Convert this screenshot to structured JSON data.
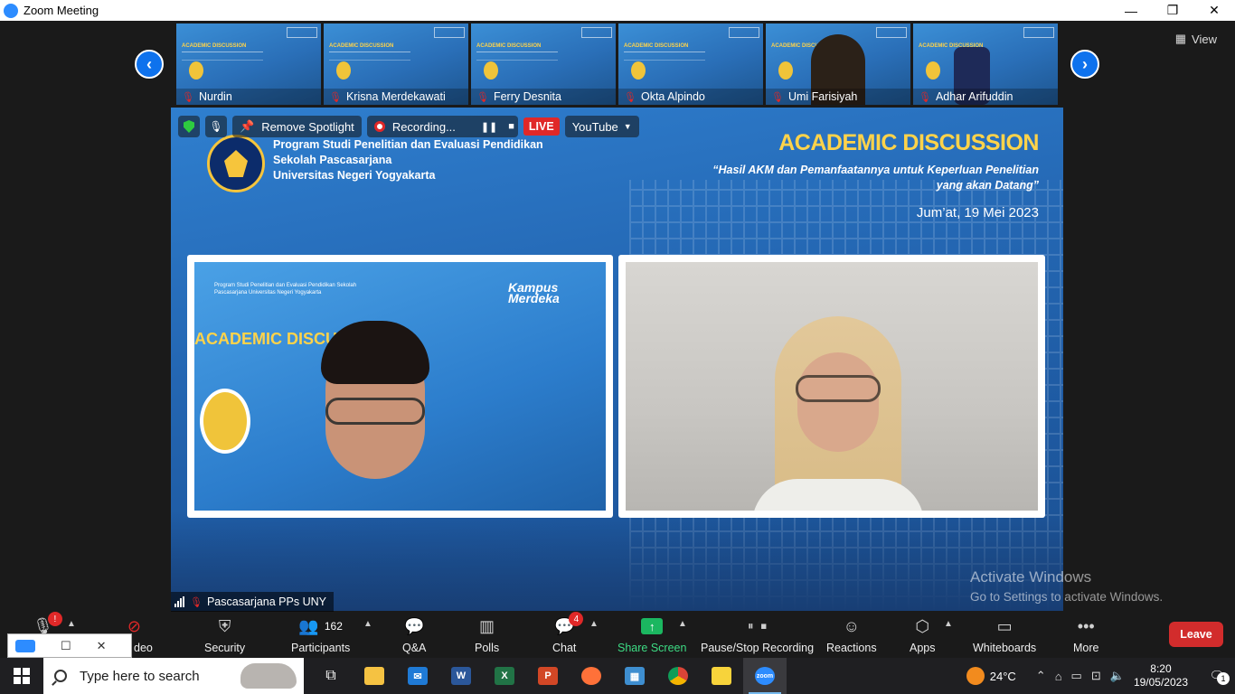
{
  "window": {
    "title": "Zoom Meeting",
    "minimize": "—",
    "restore": "❐",
    "close": "✕"
  },
  "gallery": {
    "prev_arrow": "‹",
    "next_arrow": "›",
    "view_label": "View",
    "participants": [
      {
        "name": "Nurdin",
        "muted": true
      },
      {
        "name": "Krisna Merdekawati",
        "muted": true
      },
      {
        "name": "Ferry Desnita",
        "muted": true
      },
      {
        "name": "Okta Alpindo",
        "muted": true
      },
      {
        "name": "Umi Farisiyah",
        "muted": true
      },
      {
        "name": "Adhar Arifuddin",
        "muted": true
      }
    ],
    "thumb_title": "ACADEMIC DISCUSSION"
  },
  "meeting_controls": {
    "remove_spotlight": "Remove Spotlight",
    "recording": "Recording...",
    "live": "LIVE",
    "youtube": "YouTube"
  },
  "slide": {
    "institution_line1": "Program Studi Penelitian dan Evaluasi Pendidikan",
    "institution_line2": "Sekolah Pascasarjana",
    "institution_line3": "Universitas Negeri Yogyakarta",
    "title": "ACADEMIC DISCUSSION",
    "subtitle": "“Hasil AKM dan Pemanfaatannya untuk Keperluan Penelitian yang akan Datang”",
    "date": "Jum’at, 19 Mei 2023"
  },
  "video_left": {
    "acad_text": "ACADEMIC DISCUS",
    "inst_text": "Program Studi Penelitian dan Evaluasi Pendidikan Sekolah Pascasarjana Universitas Negeri Yogyakarta",
    "kampus_text": "Kampus Merdeka"
  },
  "active_speaker": {
    "name": "Pascasarjana PPs UNY"
  },
  "watermark": {
    "line1": "Activate Windows",
    "line2": "Go to Settings to activate Windows."
  },
  "toolbar": {
    "video_label": "deo",
    "security": "Security",
    "participants": "Participants",
    "participants_count": "162",
    "qa": "Q&A",
    "polls": "Polls",
    "chat": "Chat",
    "chat_badge": "4",
    "share_screen": "Share Screen",
    "pause_stop_recording": "Pause/Stop Recording",
    "reactions": "Reactions",
    "apps": "Apps",
    "whiteboards": "Whiteboards",
    "more": "More",
    "leave": "Leave",
    "mic_badge": "!"
  },
  "taskbar": {
    "search_placeholder": "Type here to search",
    "weather": "24°C",
    "time": "8:20",
    "date": "19/05/2023",
    "notification_count": "1"
  },
  "colors": {
    "zoom_blue": "#0e72ed",
    "slide_blue": "#2467b3",
    "accent_yellow": "#ffd34a",
    "live_red": "#e02828",
    "share_green": "#1bb760",
    "leave_red": "#d22c2c"
  }
}
